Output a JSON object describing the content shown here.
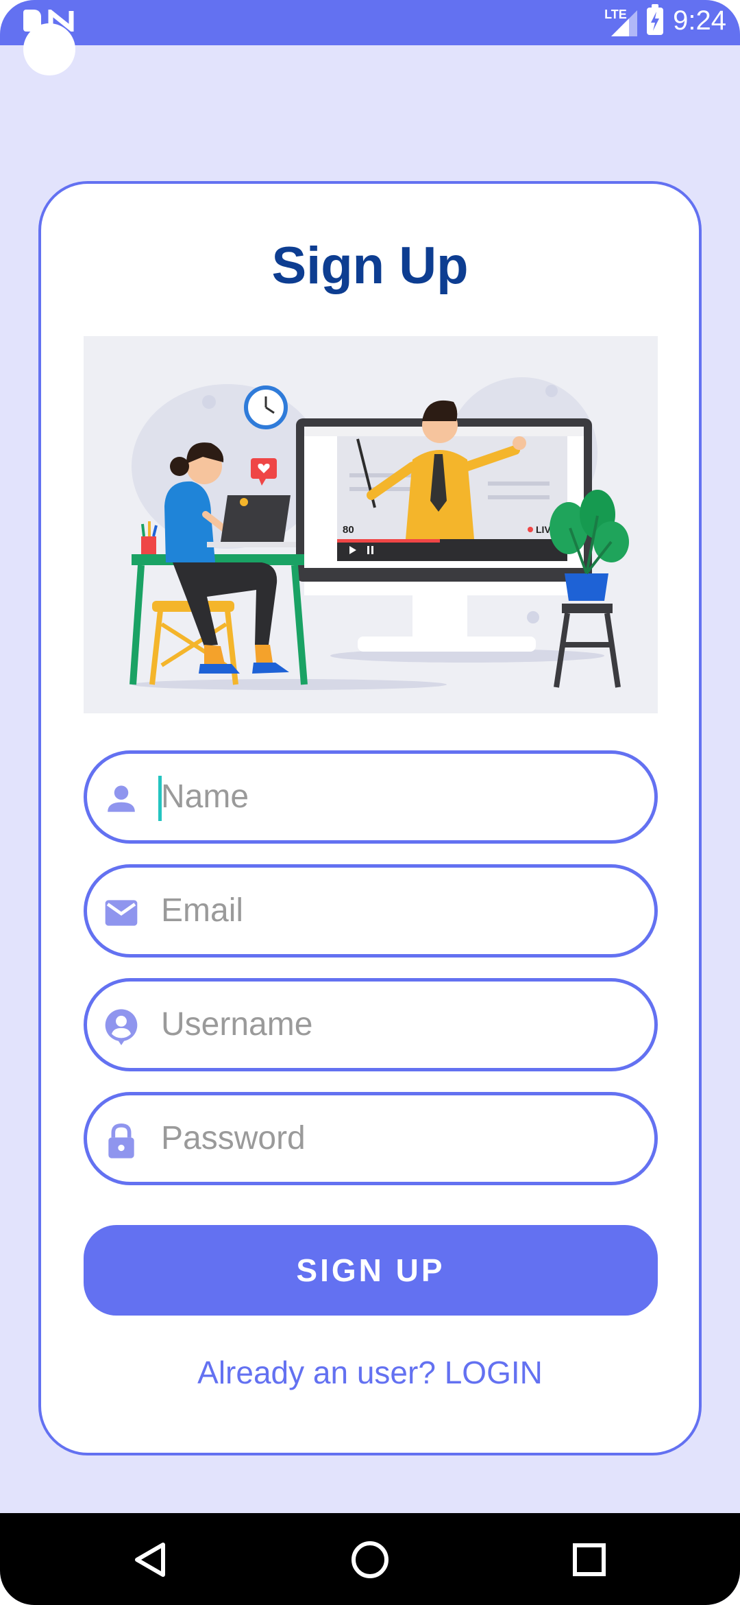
{
  "status_bar": {
    "time": "9:24",
    "network": "LTE",
    "icons": [
      "sd-card-icon",
      "n-icon",
      "signal-icon",
      "battery-icon"
    ]
  },
  "form": {
    "title": "Sign Up",
    "illustration": "online-class-illustration",
    "fields": [
      {
        "placeholder": "Name",
        "icon": "person-icon",
        "focused": true
      },
      {
        "placeholder": "Email",
        "icon": "email-icon",
        "focused": false
      },
      {
        "placeholder": "Username",
        "icon": "account-circle-icon",
        "focused": false
      },
      {
        "placeholder": "Password",
        "icon": "lock-icon",
        "focused": false
      }
    ],
    "submit_label": "SIGN UP",
    "login_prompt": "Already an user? LOGIN"
  },
  "illustration_labels": {
    "viewers": "80",
    "live": "LIVE"
  },
  "nav_bar": {
    "icons": [
      "back-icon",
      "home-icon",
      "recents-icon"
    ]
  },
  "colors": {
    "accent": "#6371f1",
    "background": "#e2e3fc",
    "title": "#0d3d91",
    "placeholder": "#9a9a9a",
    "cursor": "#24c4c0"
  }
}
